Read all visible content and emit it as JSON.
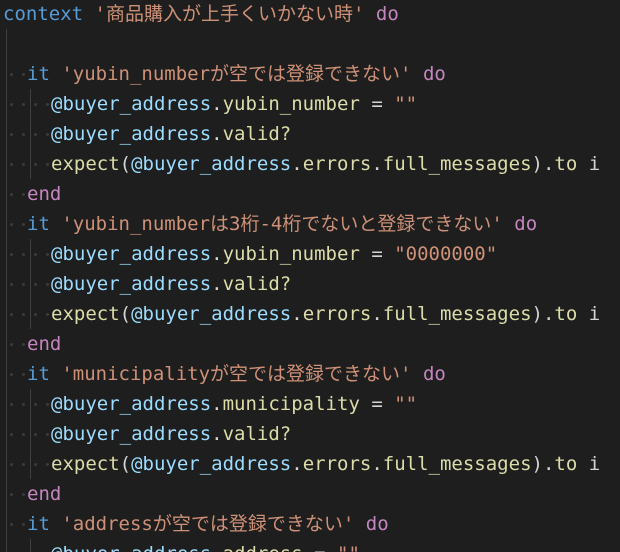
{
  "colors": {
    "background": "#1e1e1e",
    "plain": "#d4d4d4",
    "keyword": "#569cd6",
    "control": "#c586c0",
    "string": "#ce9178",
    "variable": "#9cdcfe",
    "method": "#dcdcaa",
    "indent_guide": "#404040",
    "whitespace_dot": "#3b3b3b"
  },
  "lines": [
    {
      "indent": 0,
      "tokens": [
        {
          "t": "context",
          "k": "keyword"
        },
        {
          "t": " ",
          "k": "plain"
        },
        {
          "t": "'商品購入が上手くいかない時'",
          "k": "string"
        },
        {
          "t": " ",
          "k": "plain"
        },
        {
          "t": "do",
          "k": "control"
        }
      ]
    },
    {
      "indent": 0,
      "tokens": []
    },
    {
      "indent": 1,
      "tokens": [
        {
          "t": "it",
          "k": "keyword"
        },
        {
          "t": " ",
          "k": "plain"
        },
        {
          "t": "'yubin_numberが空では登録できない'",
          "k": "string"
        },
        {
          "t": " ",
          "k": "plain"
        },
        {
          "t": "do",
          "k": "control"
        }
      ]
    },
    {
      "indent": 2,
      "tokens": [
        {
          "t": "@buyer_address",
          "k": "variable"
        },
        {
          "t": ".",
          "k": "plain"
        },
        {
          "t": "yubin_number",
          "k": "method"
        },
        {
          "t": " = ",
          "k": "plain"
        },
        {
          "t": "\"\"",
          "k": "string"
        }
      ]
    },
    {
      "indent": 2,
      "tokens": [
        {
          "t": "@buyer_address",
          "k": "variable"
        },
        {
          "t": ".",
          "k": "plain"
        },
        {
          "t": "valid?",
          "k": "method"
        }
      ]
    },
    {
      "indent": 2,
      "tokens": [
        {
          "t": "expect",
          "k": "method"
        },
        {
          "t": "(",
          "k": "plain"
        },
        {
          "t": "@buyer_address",
          "k": "variable"
        },
        {
          "t": ".",
          "k": "plain"
        },
        {
          "t": "errors",
          "k": "method"
        },
        {
          "t": ".",
          "k": "plain"
        },
        {
          "t": "full_messages",
          "k": "method"
        },
        {
          "t": ").",
          "k": "plain"
        },
        {
          "t": "to",
          "k": "method"
        },
        {
          "t": " i",
          "k": "plain"
        }
      ]
    },
    {
      "indent": 1,
      "tokens": [
        {
          "t": "end",
          "k": "control"
        }
      ]
    },
    {
      "indent": 1,
      "tokens": [
        {
          "t": "it",
          "k": "keyword"
        },
        {
          "t": " ",
          "k": "plain"
        },
        {
          "t": "'yubin_numberは3桁-4桁でないと登録できない'",
          "k": "string"
        },
        {
          "t": " ",
          "k": "plain"
        },
        {
          "t": "do",
          "k": "control"
        }
      ]
    },
    {
      "indent": 2,
      "tokens": [
        {
          "t": "@buyer_address",
          "k": "variable"
        },
        {
          "t": ".",
          "k": "plain"
        },
        {
          "t": "yubin_number",
          "k": "method"
        },
        {
          "t": " = ",
          "k": "plain"
        },
        {
          "t": "\"0000000\"",
          "k": "string"
        }
      ]
    },
    {
      "indent": 2,
      "tokens": [
        {
          "t": "@buyer_address",
          "k": "variable"
        },
        {
          "t": ".",
          "k": "plain"
        },
        {
          "t": "valid?",
          "k": "method"
        }
      ]
    },
    {
      "indent": 2,
      "tokens": [
        {
          "t": "expect",
          "k": "method"
        },
        {
          "t": "(",
          "k": "plain"
        },
        {
          "t": "@buyer_address",
          "k": "variable"
        },
        {
          "t": ".",
          "k": "plain"
        },
        {
          "t": "errors",
          "k": "method"
        },
        {
          "t": ".",
          "k": "plain"
        },
        {
          "t": "full_messages",
          "k": "method"
        },
        {
          "t": ").",
          "k": "plain"
        },
        {
          "t": "to",
          "k": "method"
        },
        {
          "t": " i",
          "k": "plain"
        }
      ]
    },
    {
      "indent": 1,
      "tokens": [
        {
          "t": "end",
          "k": "control"
        }
      ]
    },
    {
      "indent": 1,
      "tokens": [
        {
          "t": "it",
          "k": "keyword"
        },
        {
          "t": " ",
          "k": "plain"
        },
        {
          "t": "'municipalityが空では登録できない'",
          "k": "string"
        },
        {
          "t": " ",
          "k": "plain"
        },
        {
          "t": "do",
          "k": "control"
        }
      ]
    },
    {
      "indent": 2,
      "tokens": [
        {
          "t": "@buyer_address",
          "k": "variable"
        },
        {
          "t": ".",
          "k": "plain"
        },
        {
          "t": "municipality",
          "k": "method"
        },
        {
          "t": " = ",
          "k": "plain"
        },
        {
          "t": "\"\"",
          "k": "string"
        }
      ]
    },
    {
      "indent": 2,
      "tokens": [
        {
          "t": "@buyer_address",
          "k": "variable"
        },
        {
          "t": ".",
          "k": "plain"
        },
        {
          "t": "valid?",
          "k": "method"
        }
      ]
    },
    {
      "indent": 2,
      "tokens": [
        {
          "t": "expect",
          "k": "method"
        },
        {
          "t": "(",
          "k": "plain"
        },
        {
          "t": "@buyer_address",
          "k": "variable"
        },
        {
          "t": ".",
          "k": "plain"
        },
        {
          "t": "errors",
          "k": "method"
        },
        {
          "t": ".",
          "k": "plain"
        },
        {
          "t": "full_messages",
          "k": "method"
        },
        {
          "t": ").",
          "k": "plain"
        },
        {
          "t": "to",
          "k": "method"
        },
        {
          "t": " i",
          "k": "plain"
        }
      ]
    },
    {
      "indent": 1,
      "tokens": [
        {
          "t": "end",
          "k": "control"
        }
      ]
    },
    {
      "indent": 1,
      "tokens": [
        {
          "t": "it",
          "k": "keyword"
        },
        {
          "t": " ",
          "k": "plain"
        },
        {
          "t": "'addressが空では登録できない'",
          "k": "string"
        },
        {
          "t": " ",
          "k": "plain"
        },
        {
          "t": "do",
          "k": "control"
        }
      ]
    },
    {
      "indent": 2,
      "tokens": [
        {
          "t": "@buyer_address",
          "k": "variable"
        },
        {
          "t": ".",
          "k": "plain"
        },
        {
          "t": "address",
          "k": "method"
        },
        {
          "t": " = ",
          "k": "plain"
        },
        {
          "t": "\"\"",
          "k": "string"
        }
      ]
    }
  ]
}
